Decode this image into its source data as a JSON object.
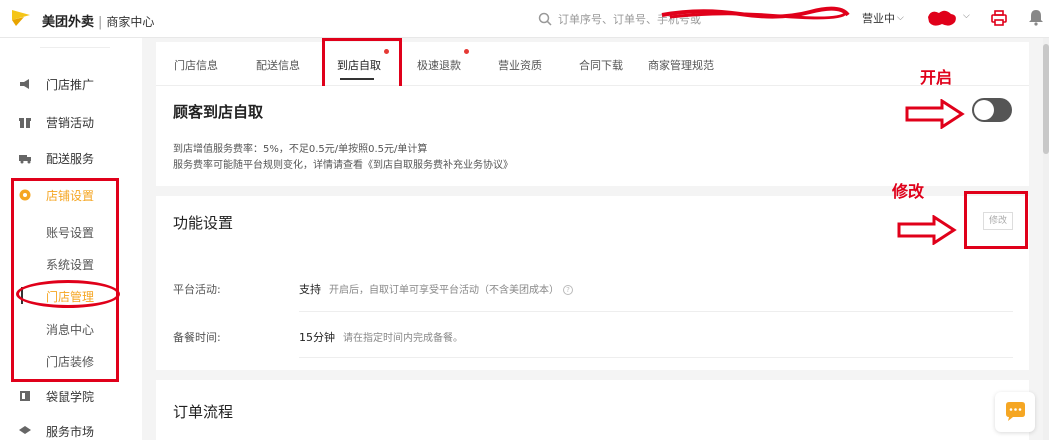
{
  "header": {
    "brand": "美团外卖",
    "brand_sub": "商家中心",
    "search_placeholder": "订单序号、订单号、手机号或",
    "status_label": "营业中"
  },
  "sidebar": {
    "items": [
      {
        "label": "门店推广",
        "icon": "megaphone-icon"
      },
      {
        "label": "营销活动",
        "icon": "gift-icon"
      },
      {
        "label": "配送服务",
        "icon": "delivery-icon"
      },
      {
        "label": "店铺设置",
        "icon": "shop-settings-icon",
        "active": true
      },
      {
        "label": "袋鼠学院",
        "icon": "book-icon"
      },
      {
        "label": "服务市场",
        "icon": "market-icon"
      }
    ],
    "sub_items": [
      {
        "label": "账号设置"
      },
      {
        "label": "系统设置"
      },
      {
        "label": "门店管理",
        "active": true
      },
      {
        "label": "消息中心"
      },
      {
        "label": "门店装修"
      }
    ]
  },
  "tabs": [
    {
      "label": "门店信息"
    },
    {
      "label": "配送信息"
    },
    {
      "label": "到店自取",
      "active": true,
      "dot": true
    },
    {
      "label": "极速退款",
      "dot": true
    },
    {
      "label": "营业资质"
    },
    {
      "label": "合同下载"
    },
    {
      "label": "商家管理规范"
    }
  ],
  "pickup": {
    "title": "顾客到店自取",
    "desc_line1": "到店增值服务费率：5%，不足0.5元/单按照0.5元/单计算",
    "desc_line2": "服务费率可能随平台规则变化，详情请查看《到店自取服务费补充业务协议》",
    "toggle_on": false
  },
  "function_settings": {
    "title": "功能设置",
    "edit_label": "修改",
    "rows": [
      {
        "label": "平台活动:",
        "value": "支持",
        "hint": "开启后，自取订单可享受平台活动（不含美团成本）"
      },
      {
        "label": "备餐时间:",
        "value": "15分钟",
        "hint": "请在指定时间内完成备餐。"
      }
    ]
  },
  "order_flow": {
    "title": "订单流程"
  },
  "annotations": {
    "open_label": "开启",
    "edit_label": "修改"
  },
  "colors": {
    "accent": "#f5a623",
    "annotation": "#e0001a",
    "toggle_off": "#555555"
  }
}
